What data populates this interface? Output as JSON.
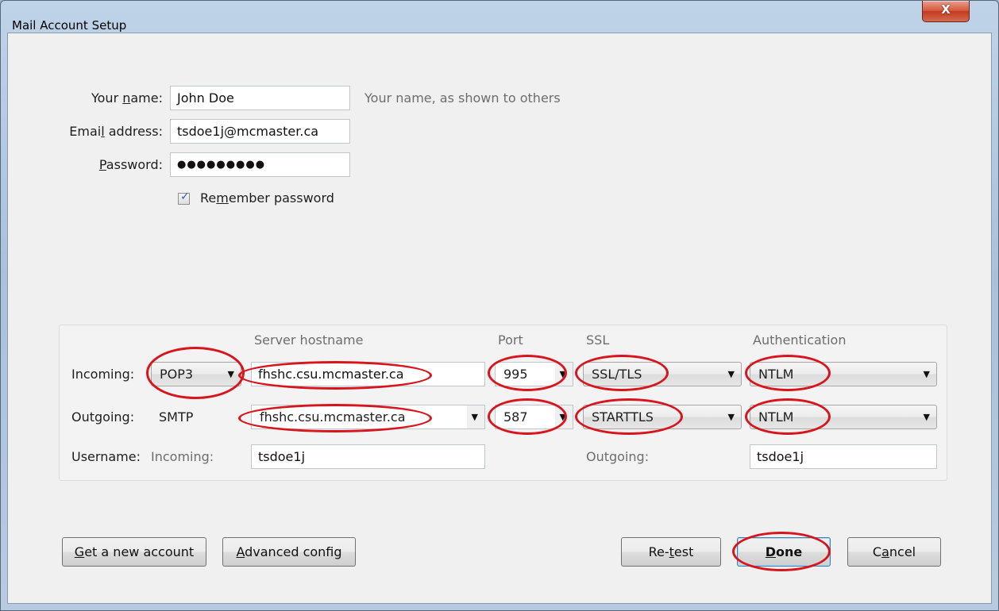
{
  "window": {
    "title": "Mail Account Setup",
    "close_label": "X"
  },
  "identity": {
    "name_label": "Your name:",
    "name_value": "John Doe",
    "name_hint": "Your name, as shown to others",
    "email_label": "Email address:",
    "email_value": "tsdoe1j@mcmaster.ca",
    "password_label": "Password:",
    "password_value": "●●●●●●●●●",
    "remember_label": "Remember password",
    "remember_checked": true
  },
  "servers": {
    "headers": {
      "hostname": "Server hostname",
      "port": "Port",
      "ssl": "SSL",
      "auth": "Authentication"
    },
    "incoming": {
      "label": "Incoming:",
      "protocol": "POP3",
      "hostname": "fhshc.csu.mcmaster.ca",
      "port": "995",
      "ssl": "SSL/TLS",
      "auth": "NTLM"
    },
    "outgoing": {
      "label": "Outgoing:",
      "protocol": "SMTP",
      "hostname": "fhshc.csu.mcmaster.ca",
      "port": "587",
      "ssl": "STARTTLS",
      "auth": "NTLM"
    },
    "username": {
      "label": "Username:",
      "incoming_label": "Incoming:",
      "incoming_value": "tsdoe1j",
      "outgoing_label": "Outgoing:",
      "outgoing_value": "tsdoe1j"
    }
  },
  "buttons": {
    "get_account": "Get a new account",
    "advanced": "Advanced config",
    "retest": "Re-test",
    "done": "Done",
    "cancel": "Cancel"
  },
  "colors": {
    "highlight_circle": "#d8141c"
  }
}
